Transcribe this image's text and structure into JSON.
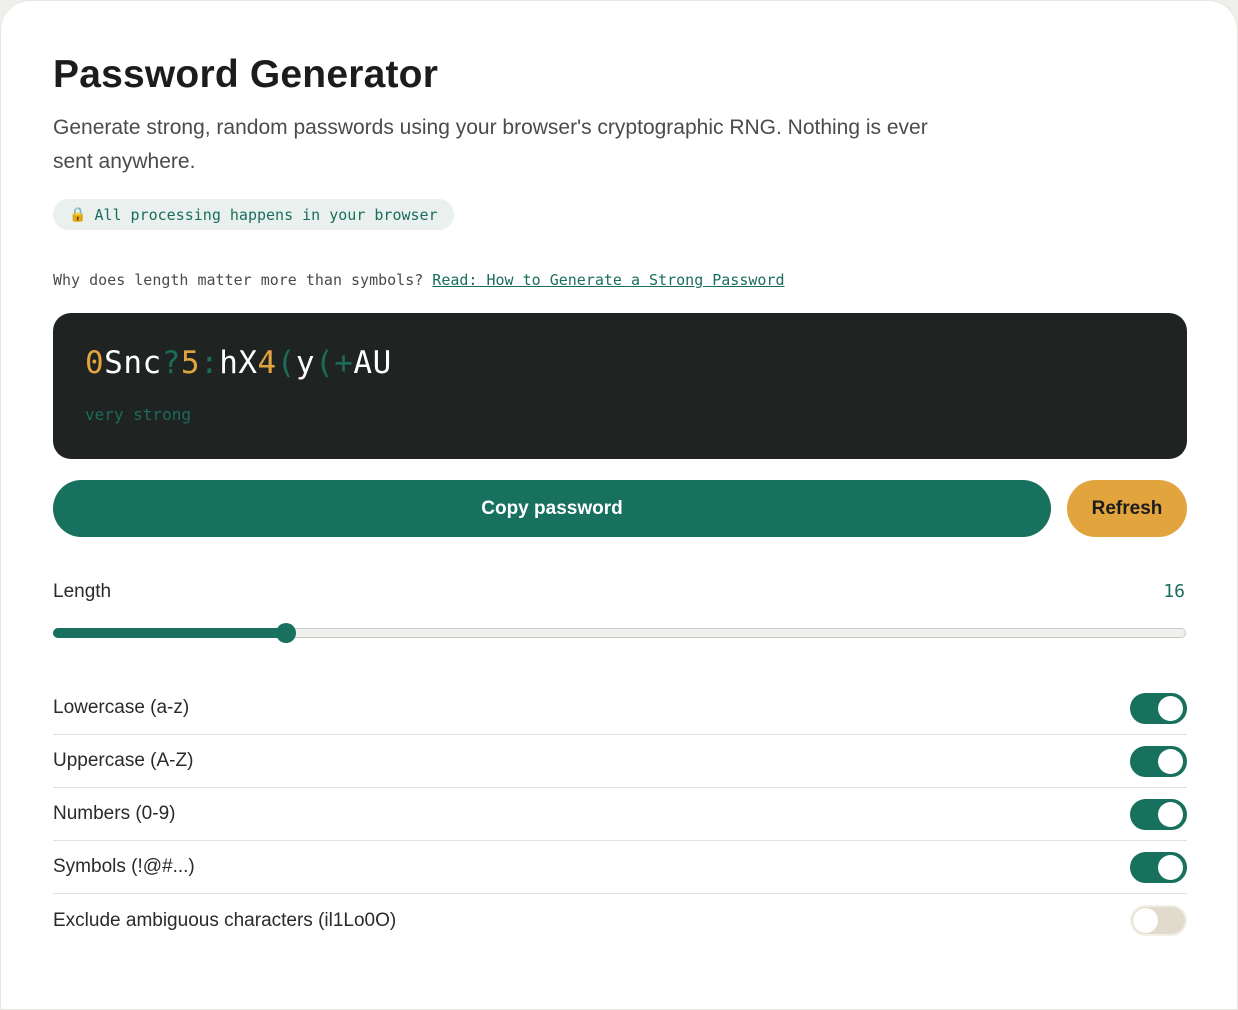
{
  "header": {
    "title": "Password Generator",
    "subtitle": "Generate strong, random passwords using your browser's cryptographic RNG. Nothing is ever sent anywhere.",
    "privacy_icon": "lock-icon",
    "privacy_text": "All processing happens in your browser"
  },
  "help": {
    "question": "Why does length matter more than symbols?",
    "link_text": "Read: How to Generate a Strong Password"
  },
  "password": {
    "value": "0Snc?5:hX4(y(+AU",
    "strength": "very strong",
    "colors": {
      "letter": "#ffffff",
      "digit": "#e2a43c",
      "symbol": "#1d6b59"
    }
  },
  "actions": {
    "copy_label": "Copy password",
    "refresh_label": "Refresh"
  },
  "length": {
    "label": "Length",
    "value": "16",
    "min": 4,
    "max": 64
  },
  "options": [
    {
      "label": "Lowercase (a-z)",
      "on": true
    },
    {
      "label": "Uppercase (A-Z)",
      "on": true
    },
    {
      "label": "Numbers (0-9)",
      "on": true
    },
    {
      "label": "Symbols (!@#...)",
      "on": true
    },
    {
      "label": "Exclude ambiguous characters (il1Lo0O)",
      "on": false
    }
  ],
  "theme": {
    "accent": "#18705f",
    "secondary": "#e2a43c",
    "dark": "#1f2322"
  }
}
